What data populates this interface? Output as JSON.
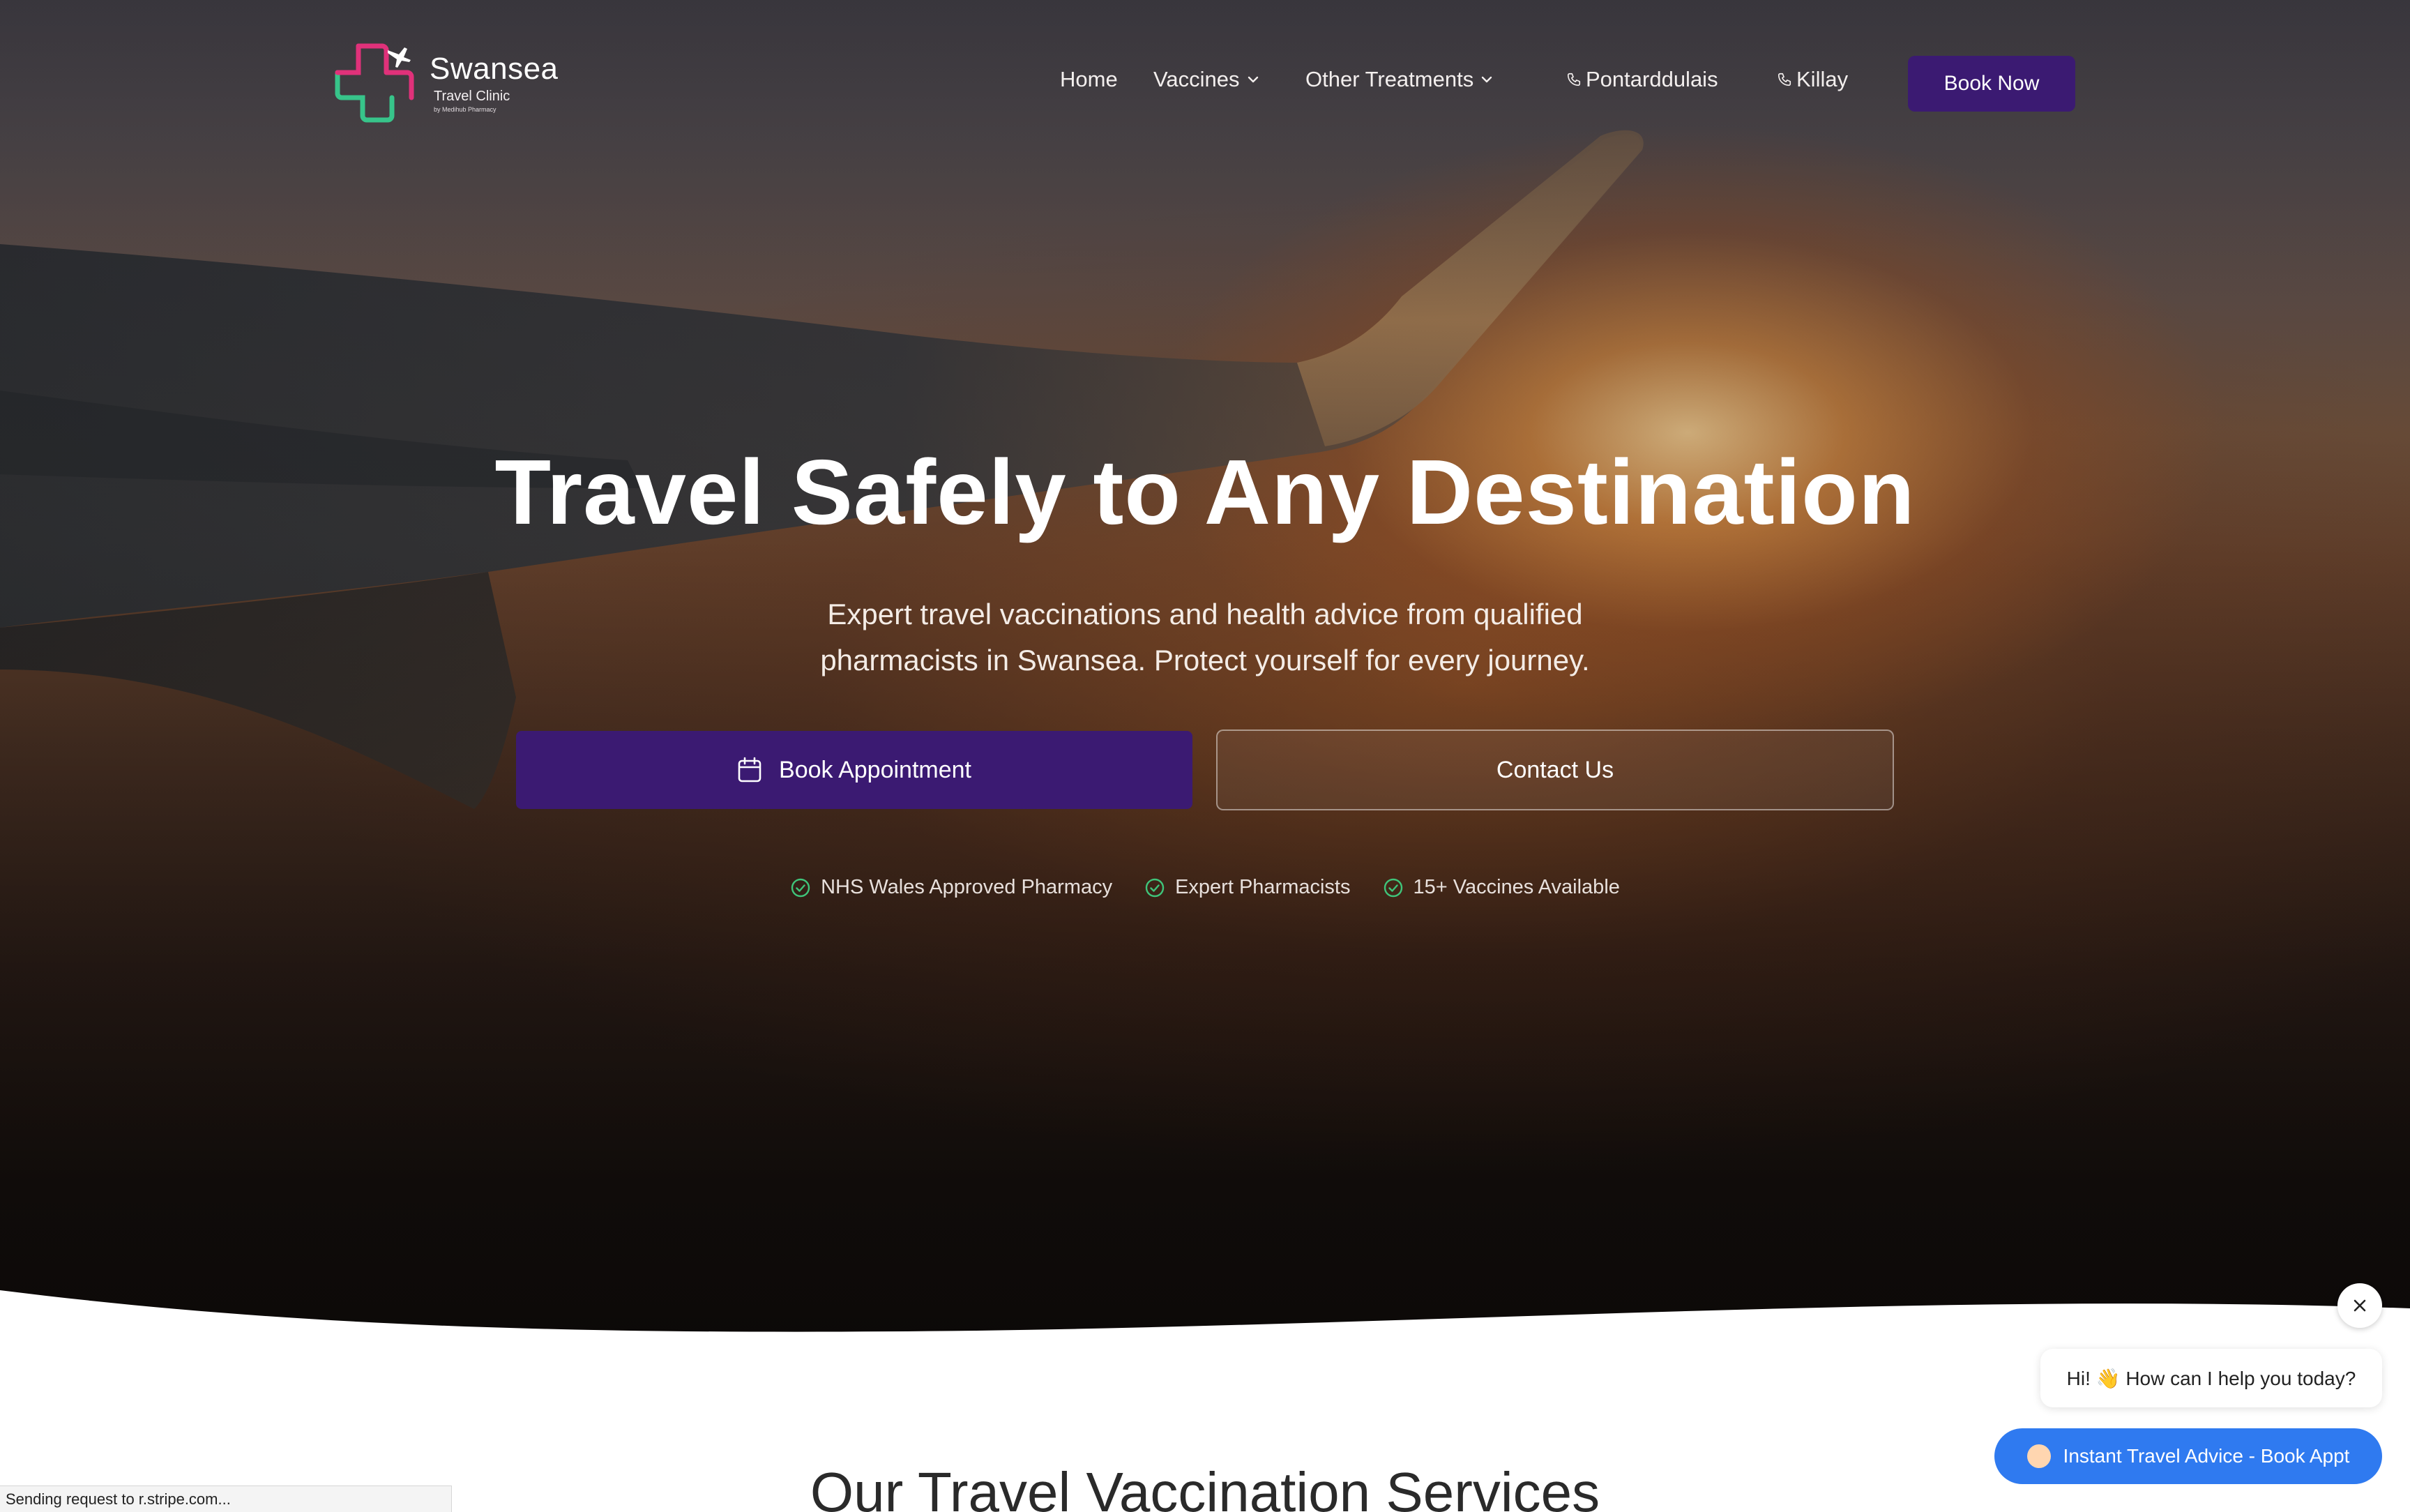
{
  "brand": {
    "name": "Swansea",
    "subtitle": "Travel Clinic",
    "byline": "by Medihub Pharmacy",
    "colors": {
      "cross_pink": "#e0317a",
      "cross_green": "#37c48a",
      "primary": "#3b1a72",
      "chat_blue": "#2f7af0"
    }
  },
  "nav": {
    "home": "Home",
    "vaccines": "Vaccines",
    "other_treatments": "Other Treatments",
    "phone_1": "Pontarddulais",
    "phone_2": "Killay",
    "book_now": "Book Now"
  },
  "hero": {
    "title": "Travel Safely to Any Destination",
    "subtitle_line1": "Expert travel vaccinations and health advice from qualified",
    "subtitle_line2": "pharmacists in Swansea. Protect yourself for every journey.",
    "primary_button": "Book Appointment",
    "secondary_button": "Contact Us",
    "badges": [
      "NHS Wales Approved Pharmacy",
      "Expert Pharmacists",
      "15+ Vaccines Available"
    ]
  },
  "section": {
    "title": "Our Travel Vaccination Services"
  },
  "chat": {
    "greeting": "Hi! 👋 How can I help you today?",
    "cta": "Instant Travel Advice - Book Appt"
  },
  "status": {
    "text": "Sending request to r.stripe.com..."
  },
  "icons": {
    "calendar": "calendar-icon",
    "check": "check-circle-icon",
    "phone": "phone-icon",
    "chevron": "chevron-down-icon",
    "close": "close-icon"
  }
}
